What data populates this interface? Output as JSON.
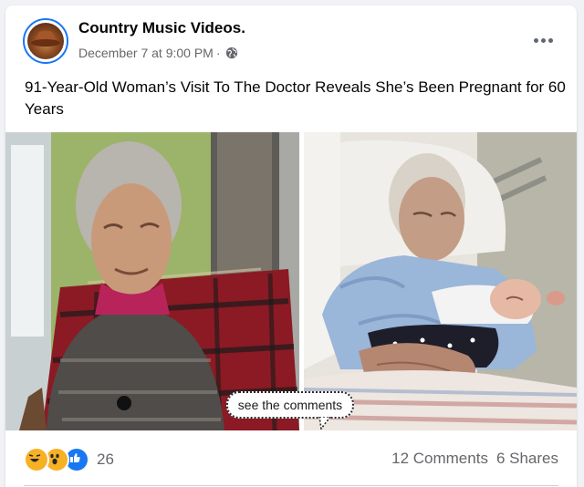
{
  "post": {
    "page_name": "Country Music Videos.",
    "timestamp": "December 7 at 9:00 PM",
    "dot": "·",
    "privacy_icon": "globe-icon",
    "more_icon": "more-options-icon",
    "caption": "91-Year-Old Woman’s Visit To The Doctor Reveals She’s Been Pregnant for 60 Years"
  },
  "media": {
    "overlay_text": "see the comments",
    "photos": [
      "elderly-woman-portrait",
      "elderly-woman-holding-newborn"
    ]
  },
  "engagement": {
    "reaction_icons": [
      "haha-reaction-icon",
      "wow-reaction-icon",
      "like-reaction-icon"
    ],
    "reaction_count": "26",
    "comments": "12 Comments",
    "shares": "6 Shares"
  },
  "colors": {
    "accent": "#1877f2",
    "secondary_text": "#65676b",
    "background": "#f0f2f5"
  }
}
